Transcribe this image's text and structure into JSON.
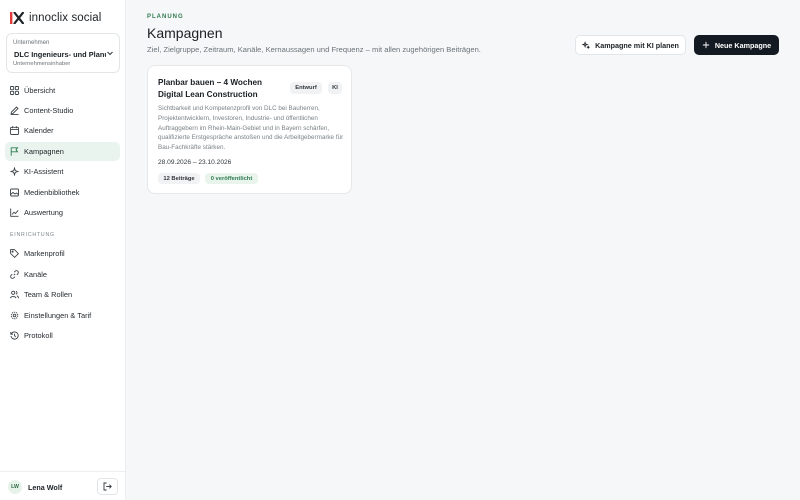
{
  "brand": {
    "name": "innoclix social"
  },
  "company": {
    "label": "Unternehmen",
    "name": "DLC Ingenieurs- und Planu",
    "role": "Unternehmensinhaber"
  },
  "nav": {
    "main": [
      {
        "label": "Übersicht",
        "icon": "grid-icon"
      },
      {
        "label": "Content-Studio",
        "icon": "pen-icon"
      },
      {
        "label": "Kalender",
        "icon": "calendar-icon"
      },
      {
        "label": "Kampagnen",
        "icon": "flag-icon",
        "active": true
      },
      {
        "label": "KI-Assistent",
        "icon": "sparkle-icon"
      },
      {
        "label": "Medienbibliothek",
        "icon": "image-icon"
      },
      {
        "label": "Auswertung",
        "icon": "chart-line-icon"
      }
    ],
    "section_label": "EINRICHTUNG",
    "setup": [
      {
        "label": "Markenprofil",
        "icon": "tag-icon"
      },
      {
        "label": "Kanäle",
        "icon": "link-icon"
      },
      {
        "label": "Team & Rollen",
        "icon": "users-icon"
      },
      {
        "label": "Einstellungen & Tarif",
        "icon": "gear-icon"
      },
      {
        "label": "Protokoll",
        "icon": "history-icon"
      }
    ]
  },
  "user": {
    "initials": "LW",
    "name": "Lena Wolf"
  },
  "header": {
    "eyebrow": "PLANUNG",
    "title": "Kampagnen",
    "subtitle": "Ziel, Zielgruppe, Zeitraum, Kanäle, Kernaussagen und Frequenz – mit allen zugehörigen Beiträgen.",
    "ki_button": "Kampagne mit KI planen",
    "new_button": "Neue Kampagne"
  },
  "campaigns": [
    {
      "title": "Planbar bauen – 4 Wochen Digital Lean Construction",
      "status": "Entwurf",
      "ki_badge": "KI",
      "description": "Sichtbarkeit und Kompetenzprofil von DLC bei Bauherren, Projektentwicklern, Investoren, Industrie- und öffentlichen Auftraggebern im Rhein-Main-Gebiet und in Bayern schärfen, qualifizierte Erstgespräche anstoßen und die Arbeitgebermarke für Bau-Fachkräfte stärken.",
      "dates": "28.09.2026 – 23.10.2026",
      "posts": "12 Beiträge",
      "published": "0 veröffentlicht"
    }
  ],
  "colors": {
    "accent": "#2f7a50",
    "active_bg": "#e9f4ee",
    "primary_button": "#141a21"
  }
}
